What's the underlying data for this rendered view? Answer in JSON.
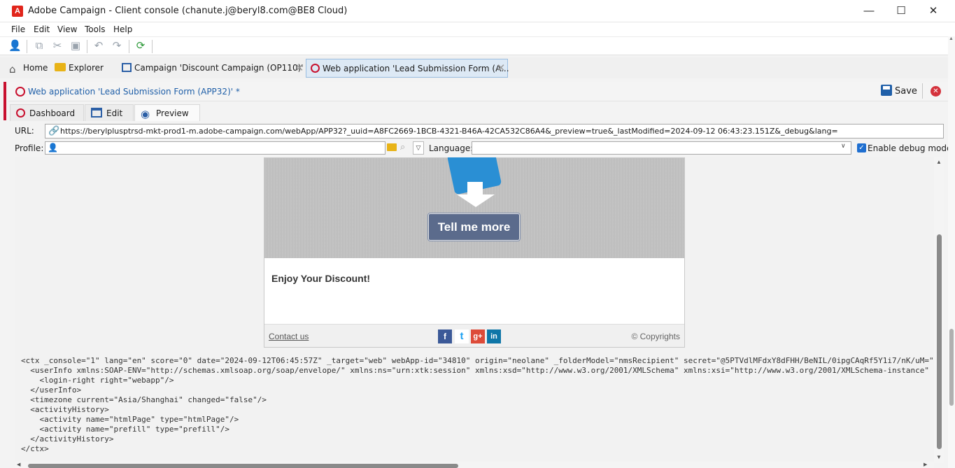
{
  "window": {
    "title": "Adobe Campaign - Client console (chanute.j@beryl8.com@BE8 Cloud)",
    "app_icon": "A",
    "minimize": "—",
    "maximize": "☐",
    "close": "✕"
  },
  "menu": [
    "File",
    "Edit",
    "View",
    "Tools",
    "Help"
  ],
  "tabs": {
    "home": "Home",
    "explorer": "Explorer",
    "campaign": "Campaign 'Discount Campaign (OP110)'",
    "webapp": "Web application 'Lead Submission Form (A..."
  },
  "document": {
    "title": "Web application 'Lead Submission Form (APP32)' *",
    "save_label": "Save"
  },
  "subtabs": {
    "dashboard": "Dashboard",
    "edit": "Edit",
    "preview": "Preview"
  },
  "url": {
    "label": "URL:",
    "value": "https://berylplusptrsd-mkt-prod1-m.adobe-campaign.com/webApp/APP32?_uuid=A8FC2669-1BCB-4321-B46A-42CA532C86A4&_preview=true&_lastModified=2024-09-12 06:43:23.151Z&_debug&lang="
  },
  "profile": {
    "label": "Profile:",
    "value": ""
  },
  "language": {
    "label": "Language:",
    "value": ""
  },
  "debug_mode": {
    "label": "Enable debug mode",
    "checked": true
  },
  "email": {
    "button": "Tell me more",
    "heading": "Enjoy Your Discount!",
    "contact": "Contact us",
    "copyright": "© Copyrights",
    "social": [
      "f",
      "t",
      "g+",
      "in"
    ]
  },
  "debug_xml": [
    "<ctx _console=\"1\" lang=\"en\" score=\"0\" date=\"2024-09-12T06:45:57Z\" _target=\"web\" webApp-id=\"34810\" origin=\"neolane\" _folderModel=\"nmsRecipient\" secret=\"@5PTVdlMFdxY8dFHH/BeNIL/0ipgCAqRf5Y1i7/nK/uM=\"",
    "  <userInfo xmlns:SOAP-ENV=\"http://schemas.xmlsoap.org/soap/envelope/\" xmlns:ns=\"urn:xtk:session\" xmlns:xsd=\"http://www.w3.org/2001/XMLSchema\" xmlns:xsi=\"http://www.w3.org/2001/XMLSchema-instance\" d",
    "    <login-right right=\"webapp\"/>",
    "  </userInfo>",
    "  <timezone current=\"Asia/Shanghai\" changed=\"false\"/>",
    "  <activityHistory>",
    "    <activity name=\"htmlPage\" type=\"htmlPage\"/>",
    "    <activity name=\"prefill\" type=\"prefill\"/>",
    "  </activityHistory>",
    "</ctx>"
  ]
}
